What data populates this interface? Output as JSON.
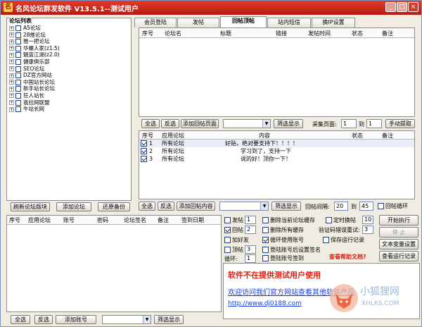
{
  "title": "名风论坛群发软件 V13.5.1--测试用户",
  "window_buttons": [
    "_",
    "□",
    "×"
  ],
  "colors": {
    "titlebar": "#d12d20",
    "link": "#1a3fd6",
    "warning": "#e02010"
  },
  "left_panel": {
    "title": "论坛列表",
    "forums": [
      "A5论坛",
      "28推论坛",
      "推一把论坛",
      "华螺人家(z1.5)",
      "魅蓝江湖(z2.0)",
      "健康俱乐部",
      "SEO论坛",
      "DZ官方网站",
      "中国站长论坛",
      "新手站长论坛",
      "狂人站长",
      "我拉网联盟",
      "牛站长网"
    ],
    "buttons": {
      "refresh": "刷新论坛版块",
      "add": "添加论坛",
      "restore": "还原备份"
    }
  },
  "tabs": [
    "会员登陆",
    "发帖",
    "回帖顶帖",
    "站内短信",
    "换IP设置"
  ],
  "active_tab": "回帖顶帖",
  "top_table": {
    "headers": [
      "序号",
      "论坛名",
      "标题",
      "链接",
      "发帖时间",
      "状态",
      "备注"
    ]
  },
  "top_controls": {
    "select_all": "全选",
    "invert": "反选",
    "add_reply_page": "添加回帖页面",
    "filter": "筛选显示",
    "collect_label": "采集页面:",
    "from": "1",
    "to_label": "到",
    "to": "1",
    "manual": "手动提取"
  },
  "reply_table": {
    "headers": [
      "序号",
      "应用论坛",
      "内容",
      "状态",
      "备注"
    ],
    "rows": [
      {
        "no": "1",
        "forum": "所有论坛",
        "content": "好贴，绝对要支持下！！！！",
        "checked": true
      },
      {
        "no": "2",
        "forum": "所有论坛",
        "content": "学习到了，支持一下",
        "checked": true
      },
      {
        "no": "3",
        "forum": "所有论坛",
        "content": "说的好！顶你一下！",
        "checked": true
      }
    ]
  },
  "mid_controls": {
    "select_all": "全选",
    "invert": "反选",
    "add_reply": "添加回帖内容",
    "filter": "筛选显示",
    "interval_label": "回帖间隔:",
    "interval_from": "20",
    "to_label": "到",
    "interval_to": "45",
    "loop": "回帖循环"
  },
  "account_table": {
    "headers": [
      "序号",
      "应用论坛",
      "账号",
      "密码",
      "论坛签名",
      "备注",
      "签到日期"
    ]
  },
  "bottom_left": {
    "select_all": "全选",
    "invert": "反选",
    "add_account": "添加账号",
    "filter": "筛选显示"
  },
  "options": {
    "post": {
      "label": "发帖",
      "value": "1",
      "checked": false
    },
    "reply": {
      "label": "回帖",
      "value": "2",
      "checked": true
    },
    "add_friend": {
      "label": "加好友",
      "checked": false
    },
    "bump": {
      "label": "顶帖",
      "value": "3",
      "checked": false
    },
    "loop_label": "循环:",
    "loop": "1",
    "del_post_cache": {
      "label": "删除当前论坛缓存",
      "checked": false
    },
    "del_all_cache": {
      "label": "删除所有缓存",
      "checked": false
    },
    "loop_account": {
      "label": "循环使用账号",
      "checked": true
    },
    "sign_after_login": {
      "label": "登陆账号后设置签名",
      "checked": false
    },
    "checkin": {
      "label": "登陆账号签到",
      "checked": false
    },
    "timed_switch": {
      "label": "定时换帖",
      "value": "10",
      "checked": false
    },
    "captcha_label": "验证码错误重试:",
    "captcha": "3",
    "save_log": {
      "label": "保存运行记录",
      "checked": false
    },
    "help": "查看帮助文档?"
  },
  "right_buttons": {
    "start": "开始执行",
    "stop": "停 止",
    "text_settings": "文本变量设置",
    "view_log": "查看运行记录"
  },
  "message": {
    "warning": "软件不在提供测试用户使用",
    "link_text": "欢迎访问我们官方网站查看其他软件产品",
    "url": "http://www.dj0188.com"
  },
  "watermark": {
    "cn": "小狐狸网",
    "en": "XHLKS.COM"
  }
}
